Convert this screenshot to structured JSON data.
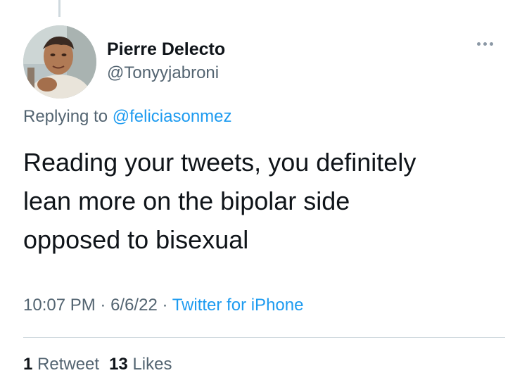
{
  "tweet": {
    "author_name": "Pierre Delecto",
    "author_handle": "@Tonyyjabroni",
    "replying_prefix": "Replying to ",
    "replying_to": "@feliciasonmez",
    "text_lines": [
      "Reading your tweets, you definitely",
      "lean more on the bipolar side",
      "opposed to bisexual"
    ],
    "time": "10:07 PM",
    "separator": " · ",
    "date": "6/6/22",
    "source": "Twitter for iPhone",
    "retweet_count": "1",
    "retweet_label": " Retweet",
    "like_count": "13",
    "like_label": " Likes"
  },
  "colors": {
    "text_primary": "#0f1419",
    "text_secondary": "#536471",
    "accent": "#1d9bf0",
    "divider": "#cfd9de"
  },
  "icons": {
    "more": "more-horizontal-icon",
    "avatar": "profile-photo"
  }
}
